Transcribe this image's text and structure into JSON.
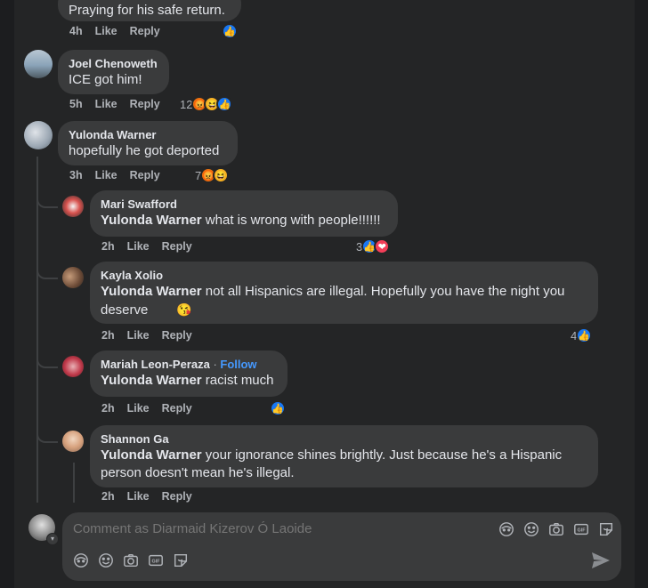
{
  "comments": [
    {
      "id": "c0",
      "text": "Praying for his safe return.",
      "time": "4h",
      "like_label": "Like",
      "reply_label": "Reply",
      "reaction_count": "",
      "reactions": [
        "like"
      ]
    },
    {
      "id": "c1",
      "author": "Joel Chenoweth",
      "text": "ICE got him!",
      "time": "5h",
      "like_label": "Like",
      "reply_label": "Reply",
      "reaction_count": "12",
      "reactions": [
        "angry",
        "haha",
        "like"
      ]
    },
    {
      "id": "c2",
      "author": "Yulonda Warner",
      "text": "hopefully he got deported",
      "time": "3h",
      "like_label": "Like",
      "reply_label": "Reply",
      "reaction_count": "7",
      "reactions": [
        "angry",
        "haha"
      ]
    }
  ],
  "replies": [
    {
      "id": "r1",
      "author": "Mari Swafford",
      "mention": "Yulonda Warner",
      "text": " what is wrong with people!!!!!!",
      "time": "2h",
      "like_label": "Like",
      "reply_label": "Reply",
      "reaction_count": "3",
      "reactions": [
        "like",
        "love"
      ]
    },
    {
      "id": "r2",
      "author": "Kayla Xolio",
      "mention": "Yulonda Warner",
      "text": " not all Hispanics are illegal. Hopefully you have the night you deserve",
      "emoji": "😘",
      "time": "2h",
      "like_label": "Like",
      "reply_label": "Reply",
      "reaction_count": "4",
      "reactions": [
        "like"
      ]
    },
    {
      "id": "r3",
      "author": "Mariah Leon-Peraza",
      "follow_sep": " · ",
      "follow_label": "Follow",
      "mention": "Yulonda Warner",
      "text": " racist much",
      "time": "2h",
      "like_label": "Like",
      "reply_label": "Reply",
      "reaction_count": "",
      "reactions": [
        "like"
      ]
    },
    {
      "id": "r4",
      "author": "Shannon Ga",
      "mention": "Yulonda Warner",
      "text": " your ignorance shines brightly. Just because he's a Hispanic person doesn't mean he's illegal.",
      "time": "2h",
      "like_label": "Like",
      "reply_label": "Reply"
    }
  ],
  "composer": {
    "placeholder": "Comment as Diarmaid Kizerov Ó Laoide",
    "icons": [
      "avatar-sticker-icon",
      "emoji-icon",
      "camera-icon",
      "gif-icon",
      "sticker-icon"
    ]
  },
  "colors": {
    "background": "#242526",
    "bubble": "#3a3b3c",
    "text": "#e4e6eb",
    "secondary": "#b0b3b8",
    "link": "#4599ff",
    "like": "#1877f2",
    "love": "#f33e58"
  }
}
